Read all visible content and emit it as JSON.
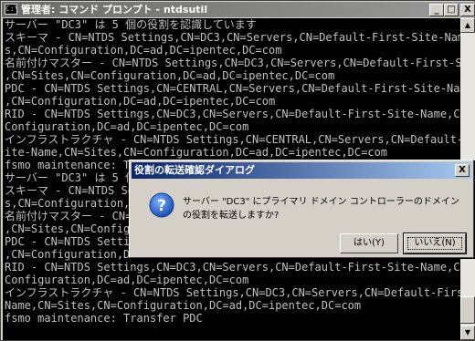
{
  "window": {
    "title": "管理者: コマンド プロンプト - ntdsutil",
    "icon_text": "C:\\",
    "minimize_glyph": "_",
    "maximize_glyph": "□",
    "close_glyph": "X"
  },
  "console": {
    "lines": [
      "サーバー \"DC3\" は 5 個の役割を認識しています",
      "スキーマ - CN=NTDS Settings,CN=DC3,CN=Servers,CN=Default-First-Site-Name,CN=Site",
      "s,CN=Configuration,DC=ad,DC=ipentec,DC=com",
      "名前付けマスター - CN=NTDS Settings,CN=DC3,CN=Servers,CN=Default-First-Site-Name",
      ",CN=Sites,CN=Configuration,DC=ad,DC=ipentec,DC=com",
      "PDC - CN=NTDS Settings,CN=CENTRAL,CN=Servers,CN=Default-First-Site-Name,CN=Sites",
      ",CN=Configuration,DC=ad,DC=ipentec,DC=com",
      "RID - CN=NTDS Settings,CN=DC3,CN=Servers,CN=Default-First-Site-Name,CN=Sites,CN=",
      "Configuration,DC=ad,DC=ipentec,DC=com",
      "インフラストラクチャ - CN=NTDS Settings,CN=CENTRAL,CN=Servers,CN=Default-First-S",
      "ite-Name,CN=Sites,CN=Configuration,DC=ad,DC=ipentec,DC=com",
      "fsmo maintenance: Transfer PDC",
      "サーバー \"DC3\" は 5 個の役",
      "スキーマ - CN=NTDS Se",
      "s,CN=Configuration,DC",
      "名前付けマスター - CN=",
      ",CN=Sites,CN=Configura",
      "PDC - CN=NTDS Setting",
      ",CN=Configuration,DC=",
      "RID - CN=NTDS Settings,CN=DC3,CN=Servers,CN=Default-First-Site-Name,CN=Sites,CN=",
      "Configuration,DC=ad,DC=ipentec,DC=com",
      "インフラストラクチャ - CN=NTDS Settings,CN=DC3,CN=Servers,CN=Default-First-Site-",
      "Name,CN=Sites,CN=Configuration,DC=ad,DC=ipentec,DC=com",
      "fsmo maintenance: Transfer PDC"
    ]
  },
  "scrollbar": {
    "up_glyph": "▲",
    "down_glyph": "▼"
  },
  "dialog": {
    "title": "役割の転送確認ダイアログ",
    "close_glyph": "X",
    "message": "サーバー \"DC3\" にプライマリ ドメイン コントローラーのドメインの役割を転送しますか?",
    "yes_label": "はい(Y)",
    "no_label": "いいえ(N)",
    "icon": "question-icon",
    "accent_color": "#0a246a"
  }
}
